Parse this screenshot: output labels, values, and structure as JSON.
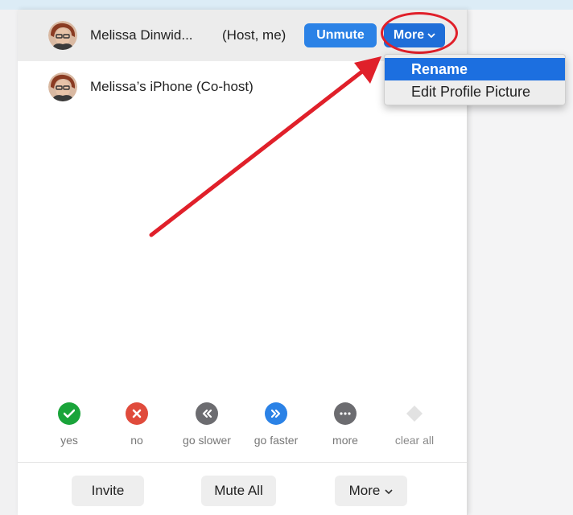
{
  "participants": [
    {
      "name": "Melissa Dinwid...",
      "role": "(Host, me)",
      "unmute_label": "Unmute",
      "more_label": "More"
    },
    {
      "name": "Melissa’s iPhone (Co-host)"
    }
  ],
  "dropdown": {
    "items": [
      "Rename",
      "Edit Profile Picture"
    ],
    "selected": "Rename"
  },
  "reactions": [
    {
      "label": "yes",
      "icon": "checkmark-icon",
      "color": "#1aa43a",
      "glyph": "✓"
    },
    {
      "label": "no",
      "icon": "x-icon",
      "color": "#e04b3c",
      "glyph": "✕"
    },
    {
      "label": "go slower",
      "icon": "rewind-icon",
      "color": "#6c6c70",
      "glyph": "«"
    },
    {
      "label": "go faster",
      "icon": "fast-forward-icon",
      "color": "#2b82e6",
      "glyph": "»"
    },
    {
      "label": "more",
      "icon": "ellipsis-icon",
      "color": "#6c6c70",
      "glyph": "···"
    },
    {
      "label": "clear all",
      "icon": "clear-icon",
      "color": "#d9d9d9",
      "glyph": ""
    }
  ],
  "bottom_bar": {
    "invite_label": "Invite",
    "mute_all_label": "Mute All",
    "more_label": "More"
  },
  "colors": {
    "accent": "#2b82e6",
    "annotation": "#e0202a"
  }
}
